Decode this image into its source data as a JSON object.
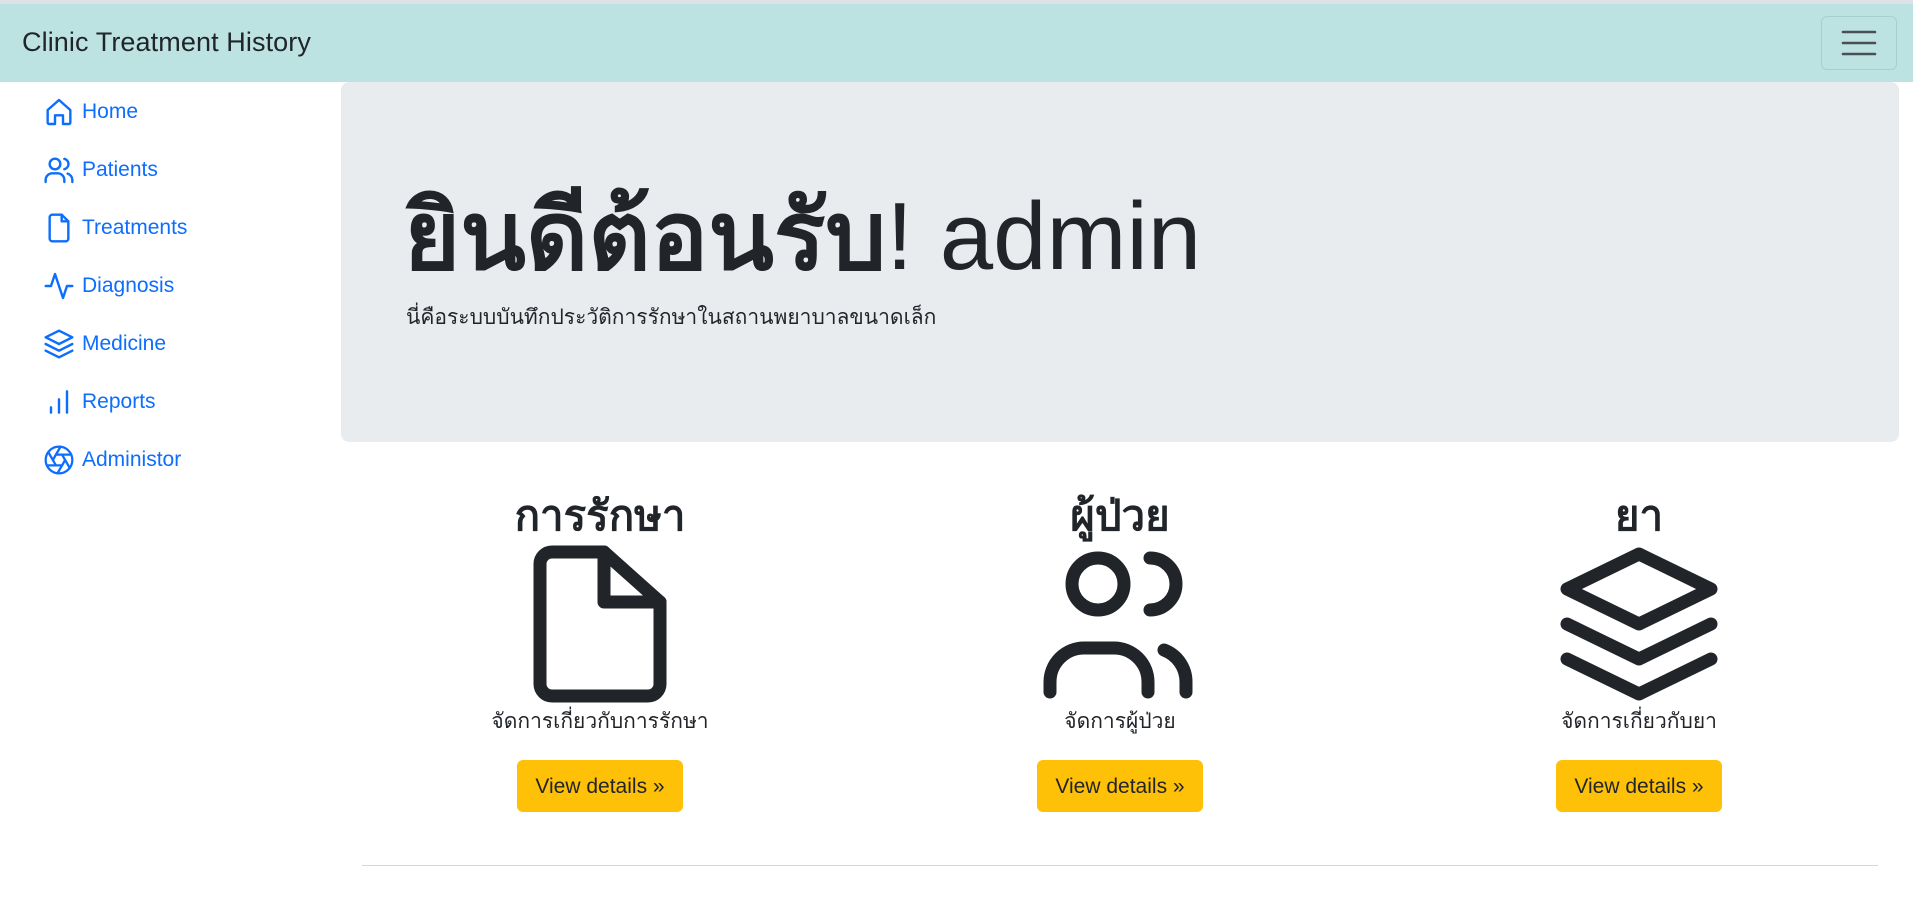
{
  "navbar": {
    "brand": "Clinic Treatment History",
    "toggler_icon": "hamburger-menu-icon"
  },
  "sidebar": {
    "items": [
      {
        "label": "Home",
        "icon": "house-icon"
      },
      {
        "label": "Patients",
        "icon": "people-icon"
      },
      {
        "label": "Treatments",
        "icon": "file-icon"
      },
      {
        "label": "Diagnosis",
        "icon": "activity-icon"
      },
      {
        "label": "Medicine",
        "icon": "layers-icon"
      },
      {
        "label": "Reports",
        "icon": "bar-chart-icon"
      },
      {
        "label": "Administor",
        "icon": "aperture-icon"
      }
    ]
  },
  "hero": {
    "title_bold": "ยินดีต้อนรับ",
    "title_rest": "! admin",
    "subtitle": "นี่คือระบบบันทึกประวัติการรักษาในสถานพยาบาลขนาดเล็ก"
  },
  "features": [
    {
      "heading": "การรักษา",
      "icon": "file-icon",
      "description": "จัดการเกี่ยวกับการรักษา",
      "button": "View details »"
    },
    {
      "heading": "ผู้ป่วย",
      "icon": "people-icon",
      "description": "จัดการผู้ป่วย",
      "button": "View details »"
    },
    {
      "heading": "ยา",
      "icon": "layers-icon",
      "description": "จัดการเกี่ยวกับยา",
      "button": "View details »"
    }
  ],
  "colors": {
    "navbar_bg": "#bce3e2",
    "link": "#0d6efd",
    "hero_bg": "#e9ecef",
    "button": "#ffc107",
    "text": "#212529"
  }
}
